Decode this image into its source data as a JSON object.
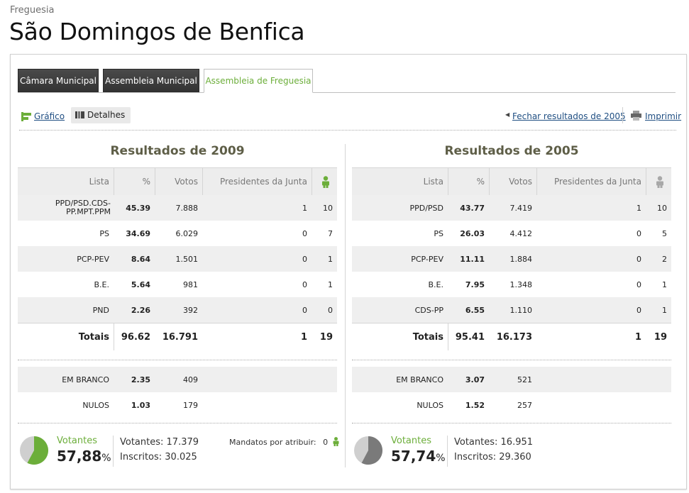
{
  "header": {
    "subtitle": "Freguesia",
    "title": "São Domingos de Benfica"
  },
  "tabs": [
    {
      "label": "Câmara Municipal",
      "active": false
    },
    {
      "label": "Assembleia Municipal",
      "active": false
    },
    {
      "label": "Assembleia de Freguesia",
      "active": true
    }
  ],
  "toolbar": {
    "grafico": "Gráfico",
    "detalhes": "Detalhes",
    "fechar": "Fechar resultados de 2005",
    "imprimir": "Imprimir"
  },
  "columns_headers": {
    "lista": "Lista",
    "pct": "%",
    "votos": "Votos",
    "presidentes": "Presidentes da Junta"
  },
  "results2009": {
    "title": "Resultados de 2009",
    "rows": [
      {
        "lista": "PPD/PSD.CDS-PP.MPT.PPM",
        "pct": "45.39",
        "votos": "7.888",
        "pres": "1",
        "mand": "10"
      },
      {
        "lista": "PS",
        "pct": "34.69",
        "votos": "6.029",
        "pres": "0",
        "mand": "7"
      },
      {
        "lista": "PCP-PEV",
        "pct": "8.64",
        "votos": "1.501",
        "pres": "0",
        "mand": "1"
      },
      {
        "lista": "B.E.",
        "pct": "5.64",
        "votos": "981",
        "pres": "0",
        "mand": "1"
      },
      {
        "lista": "PND",
        "pct": "2.26",
        "votos": "392",
        "pres": "0",
        "mand": "0"
      }
    ],
    "totais": {
      "label": "Totais",
      "pct": "96.62",
      "votos": "16.791",
      "pres": "1",
      "mand": "19"
    },
    "branco": {
      "label": "EM BRANCO",
      "pct": "2.35",
      "votos": "409"
    },
    "nulos": {
      "label": "NULOS",
      "pct": "1.03",
      "votos": "179"
    },
    "votantes_label": "Votantes",
    "votantes_pct": "57,88",
    "votantes_pct_fraction": 0.5788,
    "pct_symbol": "%",
    "votantes_line": "Votantes: 17.379",
    "inscritos_line": "Inscritos: 30.025",
    "mandatos_label": "Mandatos por atribuir:",
    "mandatos_value": "0"
  },
  "results2005": {
    "title": "Resultados de 2005",
    "rows": [
      {
        "lista": "PPD/PSD",
        "pct": "43.77",
        "votos": "7.419",
        "pres": "1",
        "mand": "10"
      },
      {
        "lista": "PS",
        "pct": "26.03",
        "votos": "4.412",
        "pres": "0",
        "mand": "5"
      },
      {
        "lista": "PCP-PEV",
        "pct": "11.11",
        "votos": "1.884",
        "pres": "0",
        "mand": "2"
      },
      {
        "lista": "B.E.",
        "pct": "7.95",
        "votos": "1.348",
        "pres": "0",
        "mand": "1"
      },
      {
        "lista": "CDS-PP",
        "pct": "6.55",
        "votos": "1.110",
        "pres": "0",
        "mand": "1"
      }
    ],
    "totais": {
      "label": "Totais",
      "pct": "95.41",
      "votos": "16.173",
      "pres": "1",
      "mand": "19"
    },
    "branco": {
      "label": "EM BRANCO",
      "pct": "3.07",
      "votos": "521"
    },
    "nulos": {
      "label": "NULOS",
      "pct": "1.52",
      "votos": "257"
    },
    "votantes_label": "Votantes",
    "votantes_pct": "57,74",
    "votantes_pct_fraction": 0.5774,
    "pct_symbol": "%",
    "votantes_line": "Votantes: 16.951",
    "inscritos_line": "Inscritos: 29.360"
  },
  "colors": {
    "accent": "#6cae3a",
    "link": "#1f4e82",
    "pie_2009": "#6cae3a",
    "pie_2005": "#7a7a7a",
    "pie_bg": "#cfcfcf"
  }
}
